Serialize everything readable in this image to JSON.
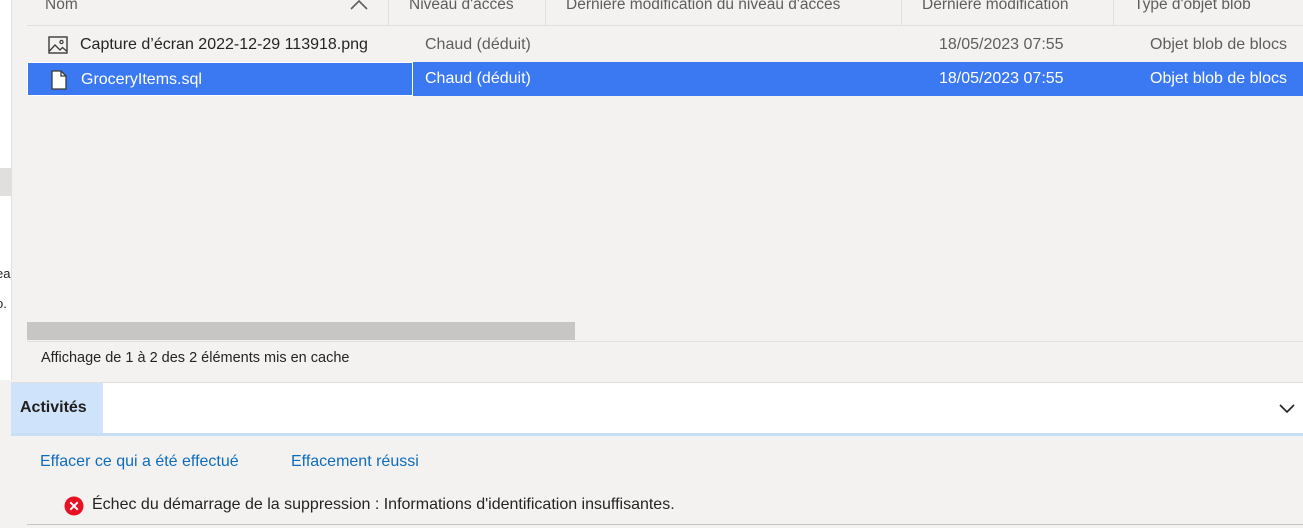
{
  "left_pane": {
    "fragments": [
      "ea",
      "o."
    ]
  },
  "table": {
    "columns": [
      {
        "label": "Nom"
      },
      {
        "label": "Niveau d'accès"
      },
      {
        "label": "Dernière modification du niveau d'accès"
      },
      {
        "label": "Dernière modification"
      },
      {
        "label": "Type d'objet blob"
      }
    ],
    "sort_icon": "chevron-up-icon",
    "rows": [
      {
        "icon": "image-file-icon",
        "name": "Capture d’écran 2022-12-29 113918.png",
        "tier": "Chaud (déduit)",
        "tier_modified": "",
        "modified": "18/05/2023 07:55",
        "blob_type": "Objet blob de blocs",
        "selected": false
      },
      {
        "icon": "document-file-icon",
        "name": "GroceryItems.sql",
        "tier": "Chaud (déduit)",
        "tier_modified": "",
        "modified": "18/05/2023 07:55",
        "blob_type": "Objet blob de blocs",
        "selected": true
      }
    ]
  },
  "status": {
    "text": "Affichage de 1 à 2 des 2 éléments mis en cache"
  },
  "activities": {
    "title": "Activités",
    "collapse_icon": "chevron-down-icon",
    "clear_done_label": "Effacer ce qui a été effectué",
    "clear_success_label": "Effacement réussi",
    "items": [
      {
        "icon": "error-icon",
        "text": "Échec du démarrage de la suppression : Informations d'identification insuffisantes."
      }
    ]
  },
  "colors": {
    "selection": "#3b79f2",
    "link": "#0f6cbd",
    "error": "#e81123",
    "activities_tab": "#cfe4fa"
  }
}
